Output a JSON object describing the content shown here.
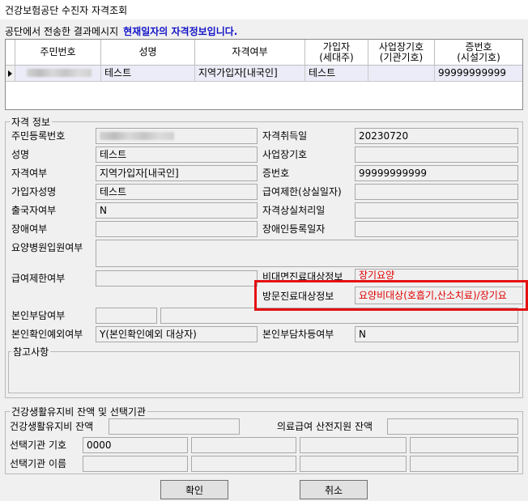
{
  "window": {
    "title": "건강보험공단 수진자 자격조회"
  },
  "message": {
    "prefix": "공단에서 전송한 결과메시지",
    "text": "현재일자의 자격정보입니다."
  },
  "grid": {
    "headers": [
      "주민번호",
      "성명",
      "자격여부",
      "가입자\n(세대주)",
      "사업장기호\n(기관기호)",
      "증번호\n(시설기호)"
    ],
    "row": {
      "name": "테스트",
      "status": "지역가입자[내국인]",
      "subscriber": "테스트",
      "workplace_code": "",
      "card_no": "99999999999"
    }
  },
  "qualification": {
    "title": "자격 정보",
    "labels": {
      "resident_no": "주민등록번호",
      "acquired": "자격취득일",
      "name": "성명",
      "workplace_code": "사업장기호",
      "status": "자격여부",
      "card_no": "증번호",
      "subscriber_name": "가입자성명",
      "benefit_limit_date": "급여제한(상실일자)",
      "departure": "출국자여부",
      "loss_processed": "자격상실처리일",
      "disability": "장애여부",
      "disability_reg": "장애인등록일자",
      "nursing_hospital": "요양병원입원여부",
      "benefit_limit": "급여제한여부",
      "non_face": "비대면진료대상정보",
      "visit": "방문진료대상정보",
      "self_pay": "본인부담여부",
      "identity_exempt": "본인확인예외여부",
      "self_pay_diff": "본인부담차등여부",
      "remarks": "참고사항"
    },
    "values": {
      "acquired": "20230720",
      "name": "테스트",
      "status": "지역가입자[내국인]",
      "card_no": "99999999999",
      "subscriber_name": "테스트",
      "departure": "N",
      "non_face": "장기요양",
      "visit": "요양비대상(호흡기,산소치료)/장기요",
      "identity_exempt": "Y(본인확인예외 대상자)",
      "self_pay_diff": "N"
    }
  },
  "health_account": {
    "title": "건강생활유지비 잔액 및 선택기관",
    "labels": {
      "balance": "건강생활유지비 잔액",
      "medical_aid": "의료급여 산전지원 잔액",
      "inst_code": "선택기관 기호",
      "inst_name": "선택기관 이름"
    },
    "values": {
      "inst_code": "0000"
    }
  },
  "buttons": {
    "ok": "확인",
    "cancel": "취소"
  },
  "colors": {
    "highlight_text": "#1414c8",
    "alert_text": "#e00000",
    "annotation_box": "#e41010"
  }
}
